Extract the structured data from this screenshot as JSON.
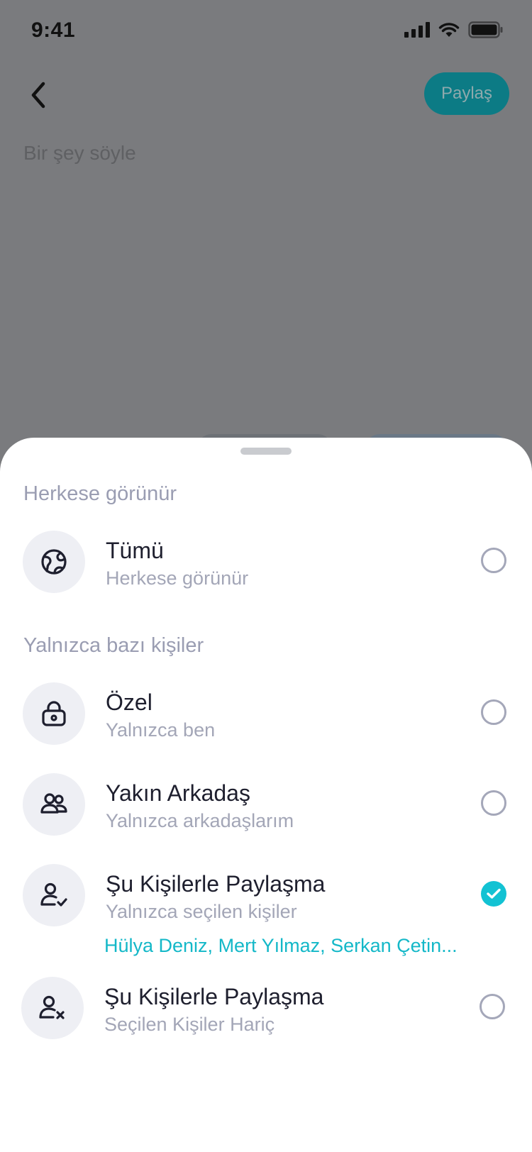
{
  "status_bar": {
    "time": "9:41"
  },
  "header": {
    "share_label": "Paylaş",
    "composer_placeholder": "Bir şey söyle"
  },
  "sheet": {
    "section_public": "Herkese görünür",
    "section_some": "Yalnızca bazı kişiler",
    "options": [
      {
        "title": "Tümü",
        "subtitle": "Herkese görünür",
        "icon": "globe-icon",
        "selected": false
      },
      {
        "title": "Özel",
        "subtitle": "Yalnızca ben",
        "icon": "lock-icon",
        "selected": false
      },
      {
        "title": "Yakın Arkadaş",
        "subtitle": "Yalnızca arkadaşlarım",
        "icon": "users-icon",
        "selected": false
      },
      {
        "title": "Şu Kişilerle Paylaşma",
        "subtitle": "Yalnızca seçilen kişiler",
        "icon": "user-check-icon",
        "selected": true
      },
      {
        "title": "Şu Kişilerle Paylaşma",
        "subtitle": "Seçilen Kişiler Hariç",
        "icon": "user-x-icon",
        "selected": false
      }
    ],
    "selected_people": "Hülya Deniz, Mert Yılmaz, Serkan Çetin..."
  },
  "colors": {
    "accent": "#12C2D3",
    "share_button": "#0C7B85",
    "section_title": "#9A9DB2"
  }
}
